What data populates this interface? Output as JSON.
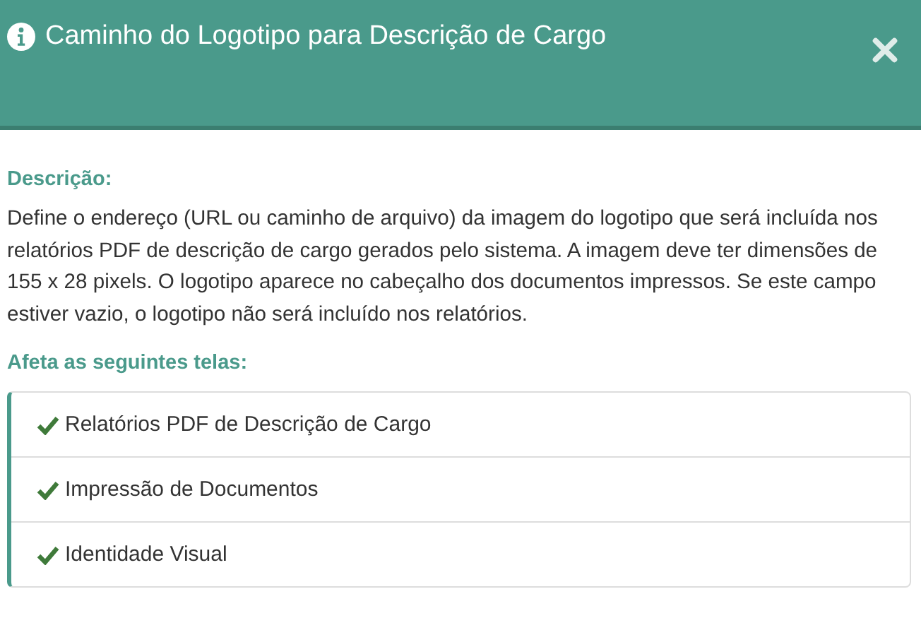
{
  "window": {
    "title": "Caminho do Logotipo para Descrição de Cargo"
  },
  "description": {
    "heading": "Descrição:",
    "text": "Define o endereço (URL ou caminho de arquivo) da imagem do logotipo que será incluída nos relatórios PDF de descrição de cargo gerados pelo sistema. A imagem deve ter dimensões de 155 x 28 pixels. O logotipo aparece no cabeçalho dos documentos impressos. Se este campo estiver vazio, o logotipo não será incluído nos relatórios."
  },
  "affected": {
    "heading": "Afeta as seguintes telas:",
    "items": [
      {
        "label": "Relatórios PDF de Descrição de Cargo",
        "checked": true
      },
      {
        "label": "Impressão de Documentos",
        "checked": true
      },
      {
        "label": "Identidade Visual",
        "checked": true
      }
    ]
  }
}
